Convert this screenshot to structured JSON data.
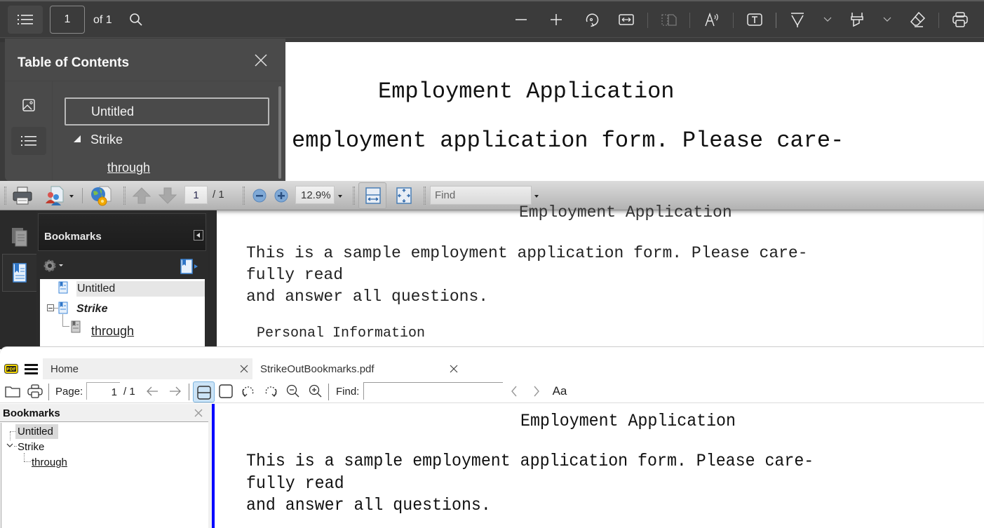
{
  "viewer1": {
    "toolbar": {
      "toc_toggle_icon": "list-icon",
      "page_number": "1",
      "page_of": "of 1",
      "search_icon": "search-icon",
      "right_icons": [
        "zoom-out-icon",
        "zoom-in-icon",
        "rotate-icon",
        "fit-width-icon",
        "two-page-icon",
        "read-aloud-icon",
        "text-box-icon",
        "draw-icon",
        "chevron-down-icon",
        "highlight-icon",
        "chevron-down-icon",
        "eraser-icon",
        "print-icon"
      ]
    },
    "toc": {
      "title": "Table of Contents",
      "rail": [
        "thumbnail-icon",
        "outline-icon"
      ],
      "items": [
        {
          "label": "Untitled",
          "selected": true
        },
        {
          "label": "Strike",
          "expanded": true
        },
        {
          "label": "through",
          "underline": true
        }
      ]
    },
    "document": {
      "title": "Employment Application",
      "line": "employment application form. Please care-"
    }
  },
  "viewer2": {
    "toolbar": {
      "page_number": "1",
      "page_total": "/ 1",
      "zoom_value": "12.9%",
      "find_placeholder": "Find"
    },
    "bookmarks": {
      "title": "Bookmarks",
      "items": [
        {
          "label": "Untitled"
        },
        {
          "label": "Strike",
          "bold_italic": true,
          "expanded": true
        },
        {
          "label": "through",
          "underline": true
        }
      ]
    },
    "document": {
      "title": "Employment Application",
      "lines": [
        "This is a sample employment application form. Please care-",
        "fully read",
        "and answer all questions."
      ],
      "section": "Personal Information"
    }
  },
  "viewer3": {
    "tabs": [
      {
        "label": "Home"
      },
      {
        "label": "StrikeOutBookmarks.pdf"
      }
    ],
    "toolbar": {
      "page_label": "Page:",
      "page_number": "1",
      "page_total": "/ 1",
      "find_label": "Find:",
      "find_value": "",
      "match_case_label": "Aa"
    },
    "bookmarks": {
      "title": "Bookmarks",
      "items": [
        {
          "label": "Untitled",
          "selected": true
        },
        {
          "label": "Strike",
          "expanded": true
        },
        {
          "label": "through",
          "underline": true
        }
      ]
    },
    "document": {
      "title": "Employment Application",
      "lines": [
        "This is a sample employment application form. Please care-",
        "fully read",
        "and answer all questions."
      ]
    },
    "accent_color": "#0000ff"
  }
}
